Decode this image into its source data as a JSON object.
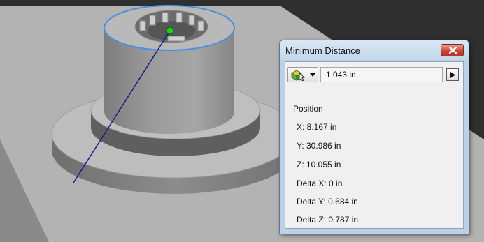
{
  "dialog": {
    "title": "Minimum Distance",
    "close_icon": "close-x-icon",
    "measure_type_icon": "measure-cursor-icon",
    "dropdown_icon": "chevron-down-icon",
    "expand_icon": "triangle-right-icon",
    "value": "1.043 in",
    "position_heading": "Position",
    "rows": [
      "X: 8.167 in",
      "Y: 30.986 in",
      "Z: 10.055 in",
      "Delta X: 0 in",
      "Delta Y: 0.684 in",
      "Delta Z: 0.787 in"
    ]
  },
  "colors": {
    "selection_highlight": "#4a90e0",
    "measure_line": "#1a1a8c",
    "point_marker": "#22cc22",
    "close_button": "#c9473a",
    "frame": "#bcd0e6"
  }
}
